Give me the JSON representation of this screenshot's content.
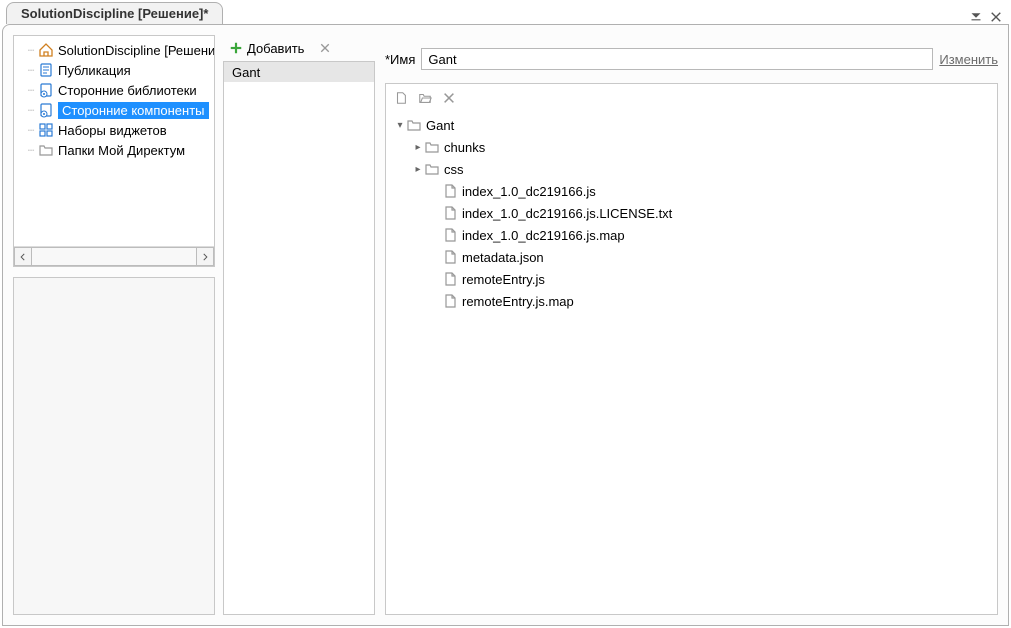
{
  "window": {
    "title": "SolutionDiscipline [Решение]*"
  },
  "nav_tree": {
    "items": [
      {
        "label": "SolutionDiscipline [Решение]",
        "icon": "home",
        "selected": false
      },
      {
        "label": "Публикация",
        "icon": "doc-blue",
        "selected": false
      },
      {
        "label": "Сторонние библиотеки",
        "icon": "gear-doc",
        "selected": false
      },
      {
        "label": "Сторонние компоненты",
        "icon": "gear-doc",
        "selected": true
      },
      {
        "label": "Наборы виджетов",
        "icon": "widgets",
        "selected": false
      },
      {
        "label": "Папки Мой Директум",
        "icon": "folder",
        "selected": false
      }
    ]
  },
  "mid_toolbar": {
    "add_label": "Добавить"
  },
  "mid_list": {
    "items": [
      {
        "label": "Gant"
      }
    ]
  },
  "form": {
    "name_label": "*Имя",
    "name_value": "Gant",
    "change_link": "Изменить"
  },
  "file_tree": [
    {
      "level": 0,
      "expander": "down",
      "icon": "folder",
      "label": "Gant"
    },
    {
      "level": 1,
      "expander": "right",
      "icon": "folder",
      "label": "chunks"
    },
    {
      "level": 1,
      "expander": "right",
      "icon": "folder",
      "label": "css"
    },
    {
      "level": 1,
      "expander": "none",
      "icon": "file",
      "label": "index_1.0_dc219166.js"
    },
    {
      "level": 1,
      "expander": "none",
      "icon": "file",
      "label": "index_1.0_dc219166.js.LICENSE.txt"
    },
    {
      "level": 1,
      "expander": "none",
      "icon": "file",
      "label": "index_1.0_dc219166.js.map"
    },
    {
      "level": 1,
      "expander": "none",
      "icon": "file",
      "label": "metadata.json"
    },
    {
      "level": 1,
      "expander": "none",
      "icon": "file",
      "label": "remoteEntry.js"
    },
    {
      "level": 1,
      "expander": "none",
      "icon": "file",
      "label": "remoteEntry.js.map"
    }
  ]
}
